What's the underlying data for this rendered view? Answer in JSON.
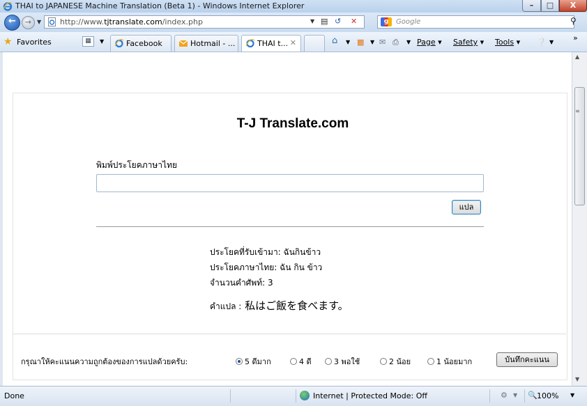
{
  "window": {
    "title": "THAI to JAPANESE Machine Translation (Beta 1) - Windows Internet Explorer",
    "min_glyph": "–",
    "max_glyph": "□",
    "close_glyph": "X"
  },
  "address_bar": {
    "url_prefix": "http://www.",
    "url_domain": "tjtranslate.com",
    "url_path": "/index.php",
    "search_placeholder": "Google"
  },
  "favorites_bar": {
    "favorites_label": "Favorites",
    "tabs": [
      {
        "label": "Facebook",
        "icon": "ie-page-icon"
      },
      {
        "label": "Hotmail - ...",
        "icon": "hotmail-icon"
      },
      {
        "label": "THAI t...",
        "icon": "ie-page-icon",
        "active": true
      }
    ],
    "commands": {
      "page": "Page",
      "safety": "Safety",
      "tools": "Tools"
    }
  },
  "page": {
    "site_title": "T-J Translate.com",
    "input_label": "พิมพ์ประโยคภาษาไทย",
    "input_value": "",
    "translate_button": "แปล",
    "results": {
      "received": "ประโยคที่รับเข้ามา: ฉันกินข้าว",
      "thai_sentence": "ประโยคภาษาไทย: ฉัน กิน ข้าว",
      "word_count": "จำนวนคำศัพท์: 3",
      "translation_label": "คำแปล :",
      "translation": "私はご飯を食べます。"
    },
    "rating": {
      "prompt": "กรุณาให้คะแนนความถูกต้องของการแปลด้วยครับ:",
      "options": [
        {
          "label": "5 ดีมาก",
          "selected": true
        },
        {
          "label": "4 ดี",
          "selected": false
        },
        {
          "label": "3 พอใช้",
          "selected": false
        },
        {
          "label": "2 น้อย",
          "selected": false
        },
        {
          "label": "1 น้อยมาก",
          "selected": false
        }
      ],
      "save_button": "บันทึกคะแนน"
    }
  },
  "status_bar": {
    "status": "Done",
    "zone": "Internet | Protected Mode: Off",
    "zoom": "100%"
  }
}
